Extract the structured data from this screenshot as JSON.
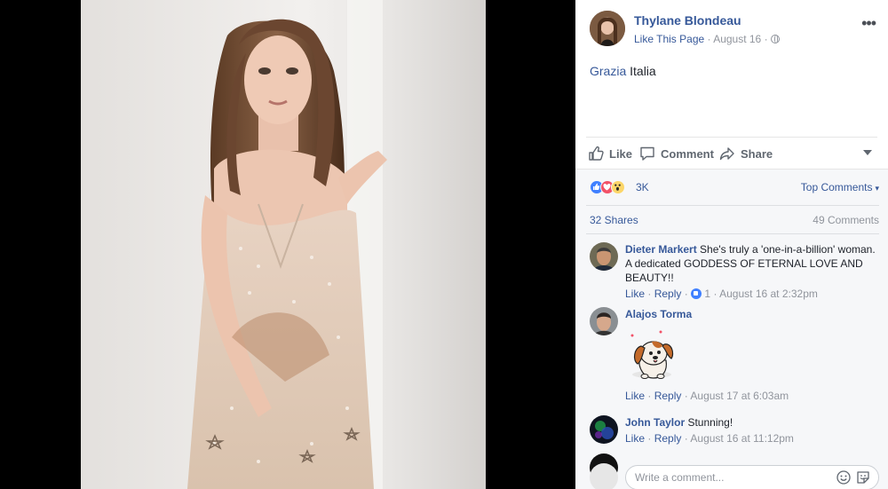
{
  "post": {
    "page_name": "Thylane Blondeau",
    "like_page": "Like This Page",
    "separator": "·",
    "date": "August 16",
    "more": "•••",
    "text_mention": "Grazia",
    "text_rest": " Italia"
  },
  "actions": {
    "like": "Like",
    "comment": "Comment",
    "share": "Share"
  },
  "reactions": {
    "count": "3K",
    "top_comments": "Top Comments",
    "shares": "32 Shares",
    "comments": "49 Comments"
  },
  "comments": [
    {
      "author": "Dieter Markert",
      "text": " She's truly a 'one-in-a-billion' woman. A dedicated GODDESS OF ETERNAL LOVE AND BEAUTY!!",
      "like": "Like",
      "reply": "Reply",
      "reaction_count": "1",
      "time": "August 16 at 2:32pm"
    },
    {
      "author": "Alajos Torma",
      "text": "",
      "like": "Like",
      "reply": "Reply",
      "time": "August 17 at 6:03am"
    },
    {
      "author": "John Taylor",
      "text": " Stunning!",
      "like": "Like",
      "reply": "Reply",
      "time": "August 16 at 11:12pm"
    }
  ],
  "composer": {
    "placeholder": "Write a comment..."
  },
  "icons": {
    "like": "thumbs-up-icon",
    "comment": "speech-bubble-icon",
    "share": "share-arrow-icon",
    "globe": "globe-icon",
    "emoji": "smiley-icon",
    "camera": "camera-icon"
  },
  "colors": {
    "link_blue": "#365899",
    "meta_grey": "#90949c",
    "like_blue": "#4080ff",
    "love_red": "#f25268",
    "wow_yellow": "#fcd669"
  }
}
